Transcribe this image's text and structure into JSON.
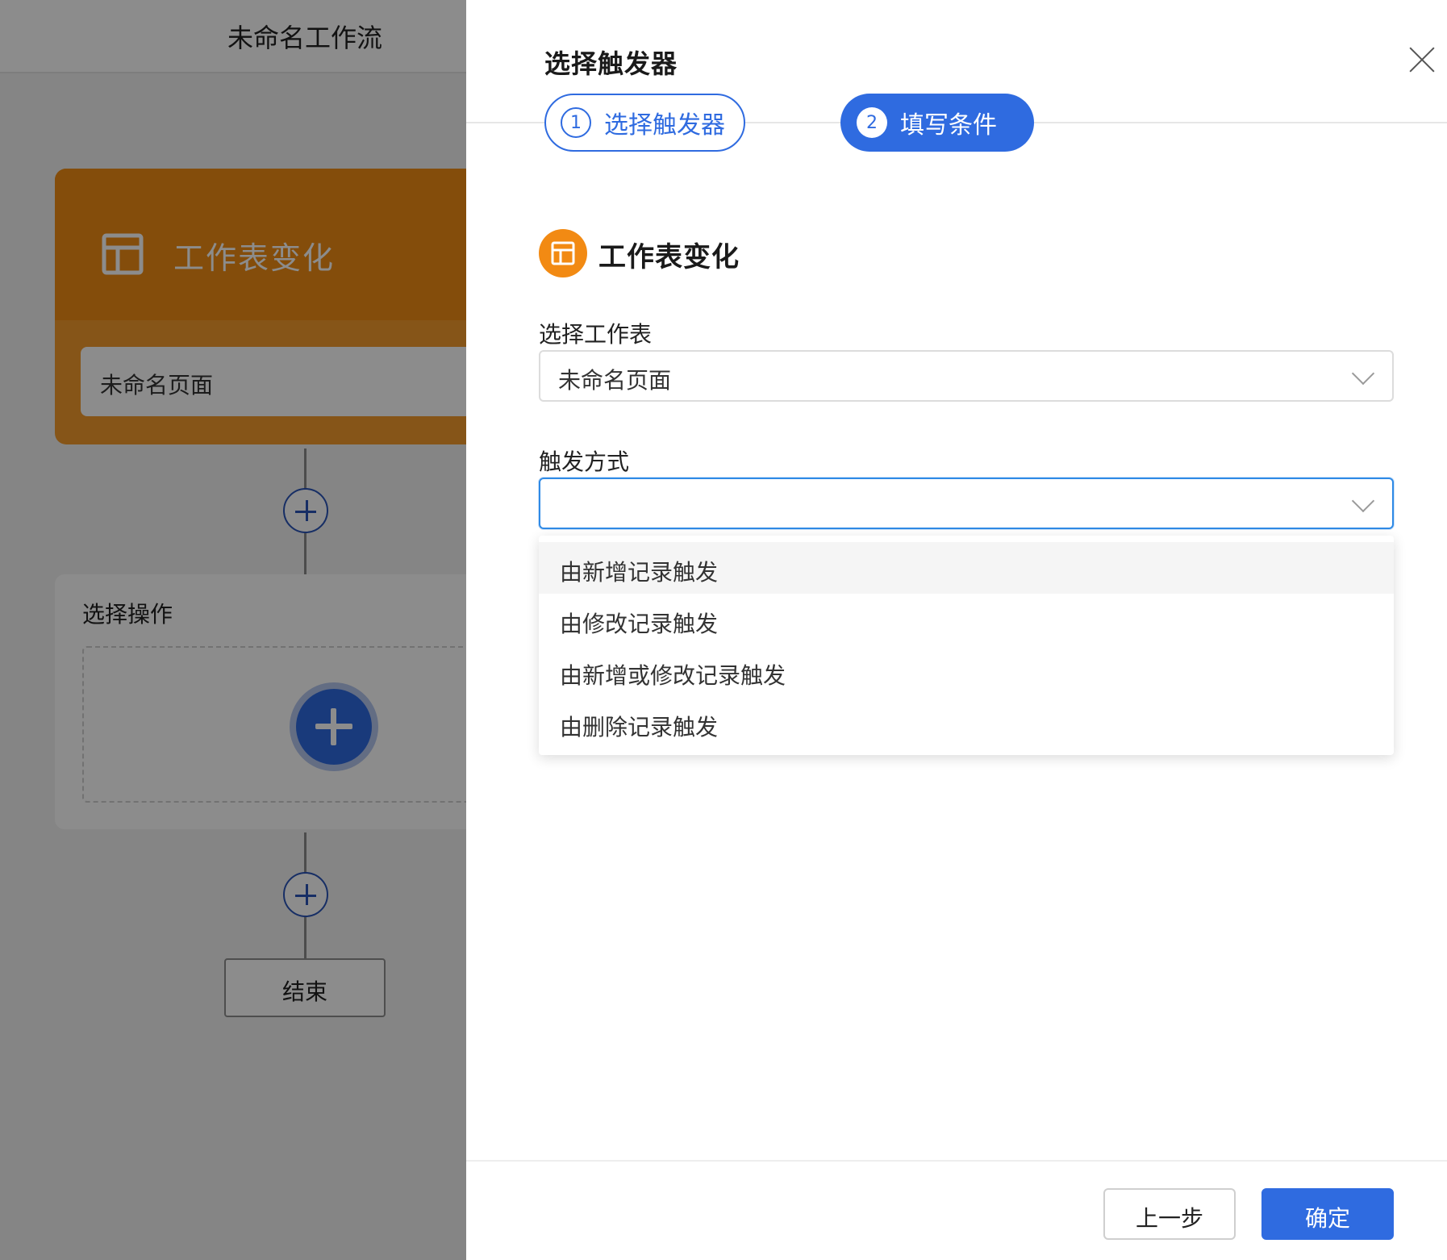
{
  "workflow": {
    "title": "未命名工作流",
    "trigger_card": {
      "title": "工作表变化",
      "page": "未命名页面",
      "icon": "table-icon"
    },
    "action_card": {
      "title": "选择操作"
    },
    "end_label": "结束"
  },
  "drawer": {
    "title": "选择触发器",
    "steps": [
      {
        "number": "1",
        "label": "选择触发器"
      },
      {
        "number": "2",
        "label": "填写条件"
      }
    ],
    "section": {
      "title": "工作表变化",
      "icon": "table-icon"
    },
    "sheet_field": {
      "label": "选择工作表",
      "value": "未命名页面"
    },
    "mode_field": {
      "label": "触发方式",
      "value": ""
    },
    "mode_options": [
      "由新增记录触发",
      "由修改记录触发",
      "由新增或修改记录触发",
      "由删除记录触发"
    ],
    "footer": {
      "prev_label": "上一步",
      "ok_label": "确定"
    }
  },
  "colors": {
    "accent": "#2f6be0",
    "trigger": "#f08d14"
  }
}
